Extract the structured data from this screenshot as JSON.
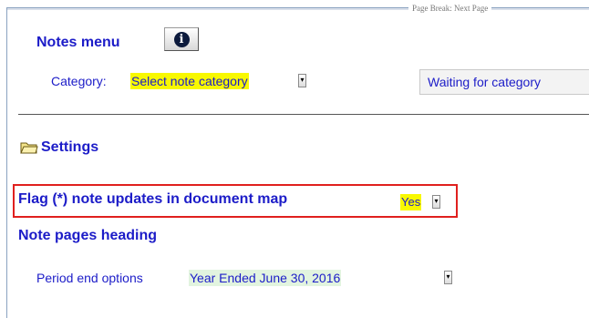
{
  "page_break": "Page Break: Next Page",
  "notes_menu": {
    "title": "Notes menu",
    "info_icon": "info-icon",
    "category_label": "Category:",
    "category_value": "Select note category",
    "waiting_button": "Waiting for category"
  },
  "settings": {
    "title": "Settings",
    "folder_icon": "folder-icon",
    "flag_label": "Flag (*) note updates in document map",
    "flag_value": "Yes",
    "note_pages_heading": "Note pages heading",
    "period_label": "Period end options",
    "period_value": "Year Ended June 30, 2016"
  },
  "colors": {
    "text": "#1c1cc8",
    "field_yellow": "#f8f800",
    "field_green": "#e2f4df",
    "highlight_border": "#e0201e"
  }
}
